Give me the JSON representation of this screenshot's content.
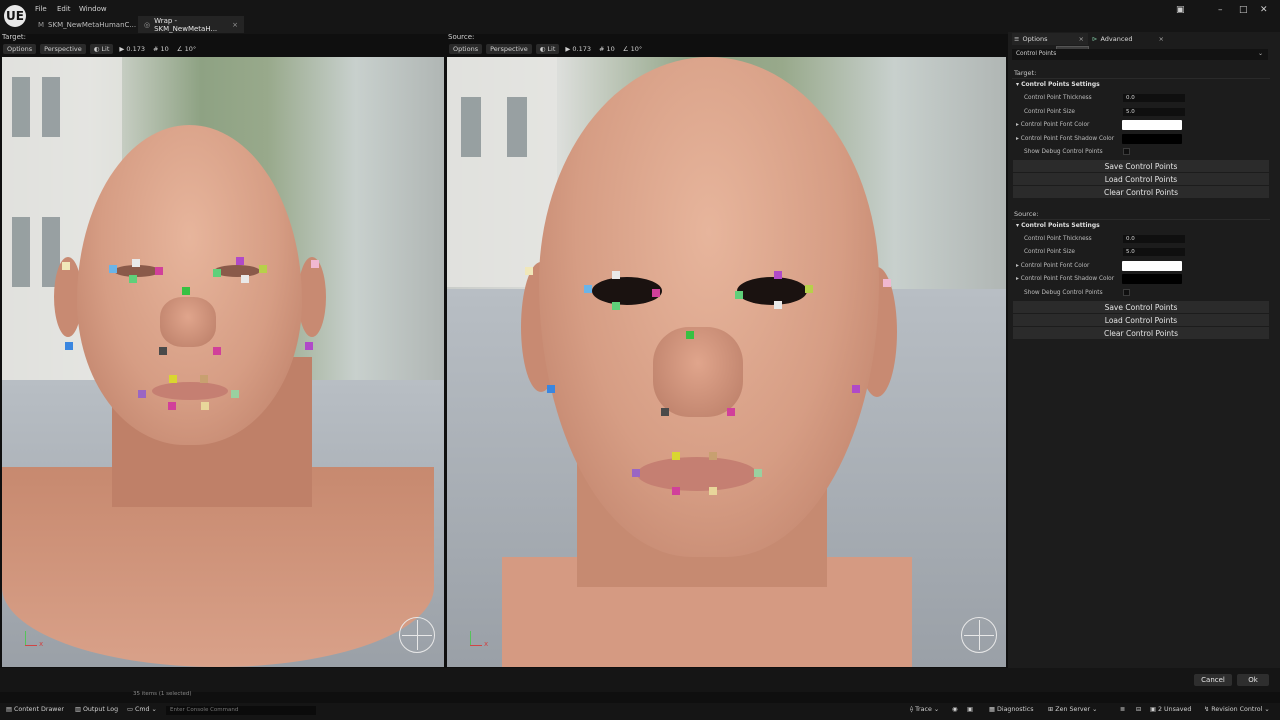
{
  "app": {
    "logo": "UE",
    "menu": [
      "File",
      "Edit",
      "Window"
    ],
    "tabs": [
      {
        "label": "SKM_NewMetaHumanC...",
        "active": false
      },
      {
        "label": "Wrap - SKM_NewMetaH...",
        "active": true
      }
    ],
    "close_glyph": "×"
  },
  "viewports": {
    "target": {
      "label": "Target:",
      "toolbar": {
        "options": "Options",
        "perspective": "Perspective",
        "lit": "Lit",
        "speed": "0.173",
        "grid": "10",
        "angle": "10°"
      }
    },
    "source": {
      "label": "Source:",
      "toolbar": {
        "options": "Options",
        "perspective": "Perspective",
        "lit": "Lit",
        "speed": "0.173",
        "grid": "10",
        "angle": "10°"
      }
    },
    "axis_x": "x"
  },
  "panel": {
    "tabs": {
      "options": "Options",
      "advanced": "Advanced"
    },
    "tooltip": "Options",
    "dropdown_label": "Control Points",
    "target": {
      "label": "Target:",
      "settings_title": "Control Points Settings",
      "thickness_label": "Control Point Thickness",
      "thickness_value": "0.0",
      "size_label": "Control Point Size",
      "size_value": "5.0",
      "font_color_label": "Control Point Font Color",
      "font_color": "#ffffff",
      "shadow_color_label": "Control Point Font Shadow Color",
      "shadow_color": "#000000",
      "debug_label": "Show Debug Control Points",
      "save": "Save Control Points",
      "load": "Load Control Points",
      "clear": "Clear Control Points"
    },
    "source": {
      "label": "Source:",
      "settings_title": "Control Points Settings",
      "thickness_label": "Control Point Thickness",
      "thickness_value": "0.0",
      "size_label": "Control Point Size",
      "size_value": "5.0",
      "font_color_label": "Control Point Font Color",
      "font_color": "#ffffff",
      "shadow_color_label": "Control Point Font Shadow Color",
      "shadow_color": "#000000",
      "debug_label": "Show Debug Control Points",
      "save": "Save Control Points",
      "load": "Load Control Points",
      "clear": "Clear Control Points"
    }
  },
  "dialog": {
    "cancel": "Cancel",
    "ok": "Ok",
    "items_status": "35 items (1 selected)"
  },
  "statusbar": {
    "content_drawer": "Content Drawer",
    "output_log": "Output Log",
    "cmd": "Cmd",
    "console_placeholder": "Enter Console Command",
    "trace": "Trace",
    "diagnostics": "Diagnostics",
    "zen_server": "Zen Server",
    "unsaved": "2 Unsaved",
    "revision_control": "Revision Control"
  },
  "colors": {
    "accent_blue": "#4a90d9",
    "panel_bg": "#1c1c1c"
  }
}
